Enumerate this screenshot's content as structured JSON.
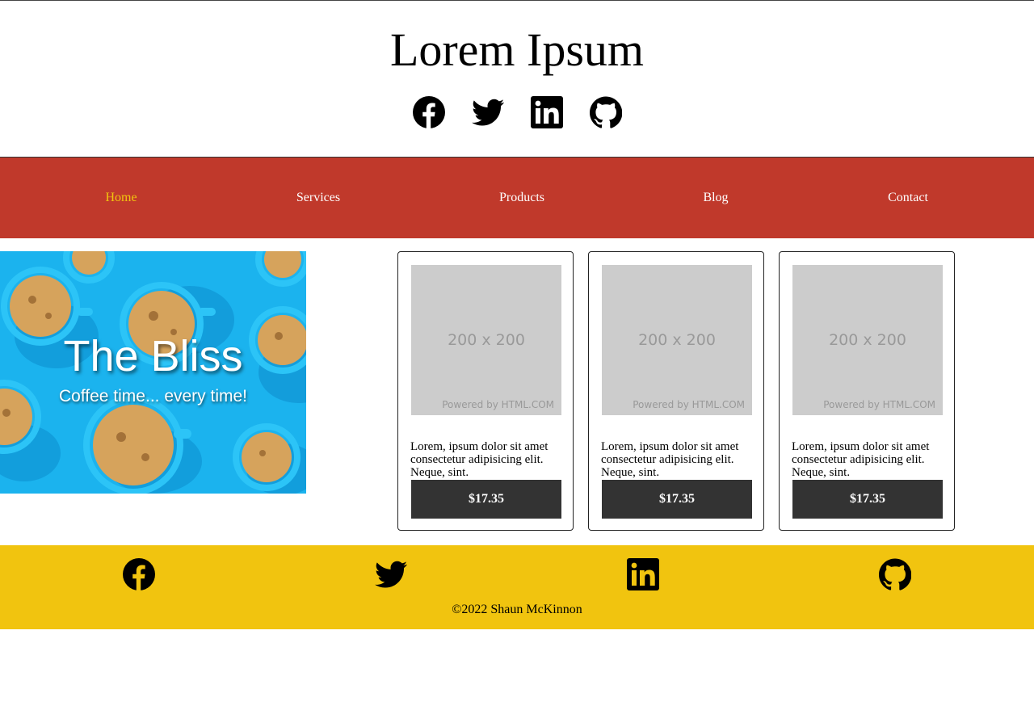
{
  "header": {
    "title": "Lorem Ipsum",
    "social": [
      {
        "icon": "facebook-icon"
      },
      {
        "icon": "twitter-icon"
      },
      {
        "icon": "linkedin-icon"
      },
      {
        "icon": "github-icon"
      }
    ]
  },
  "nav": {
    "items": [
      {
        "label": "Home",
        "active": true
      },
      {
        "label": "Services"
      },
      {
        "label": "Products"
      },
      {
        "label": "Blog"
      },
      {
        "label": "Contact"
      }
    ]
  },
  "hero": {
    "title": "The Bliss",
    "tagline": "Coffee time... every time!"
  },
  "products": [
    {
      "image_size": "200 x 200",
      "image_credit": "Powered by HTML.COM",
      "description": "Lorem, ipsum dolor sit amet consectetur adipisicing elit. Neque, sint.",
      "price": "$17.35"
    },
    {
      "image_size": "200 x 200",
      "image_credit": "Powered by HTML.COM",
      "description": "Lorem, ipsum dolor sit amet consectetur adipisicing elit. Neque, sint.",
      "price": "$17.35"
    },
    {
      "image_size": "200 x 200",
      "image_credit": "Powered by HTML.COM",
      "description": "Lorem, ipsum dolor sit amet consectetur adipisicing elit. Neque, sint.",
      "price": "$17.35"
    }
  ],
  "footer": {
    "copyright": "©2022 Shaun McKinnon"
  },
  "colors": {
    "nav_bg": "#c0392b",
    "nav_active": "#f1c40f",
    "footer_bg": "#f1c40f",
    "button_bg": "#333333",
    "hero_bg": "#1bb3ee"
  }
}
